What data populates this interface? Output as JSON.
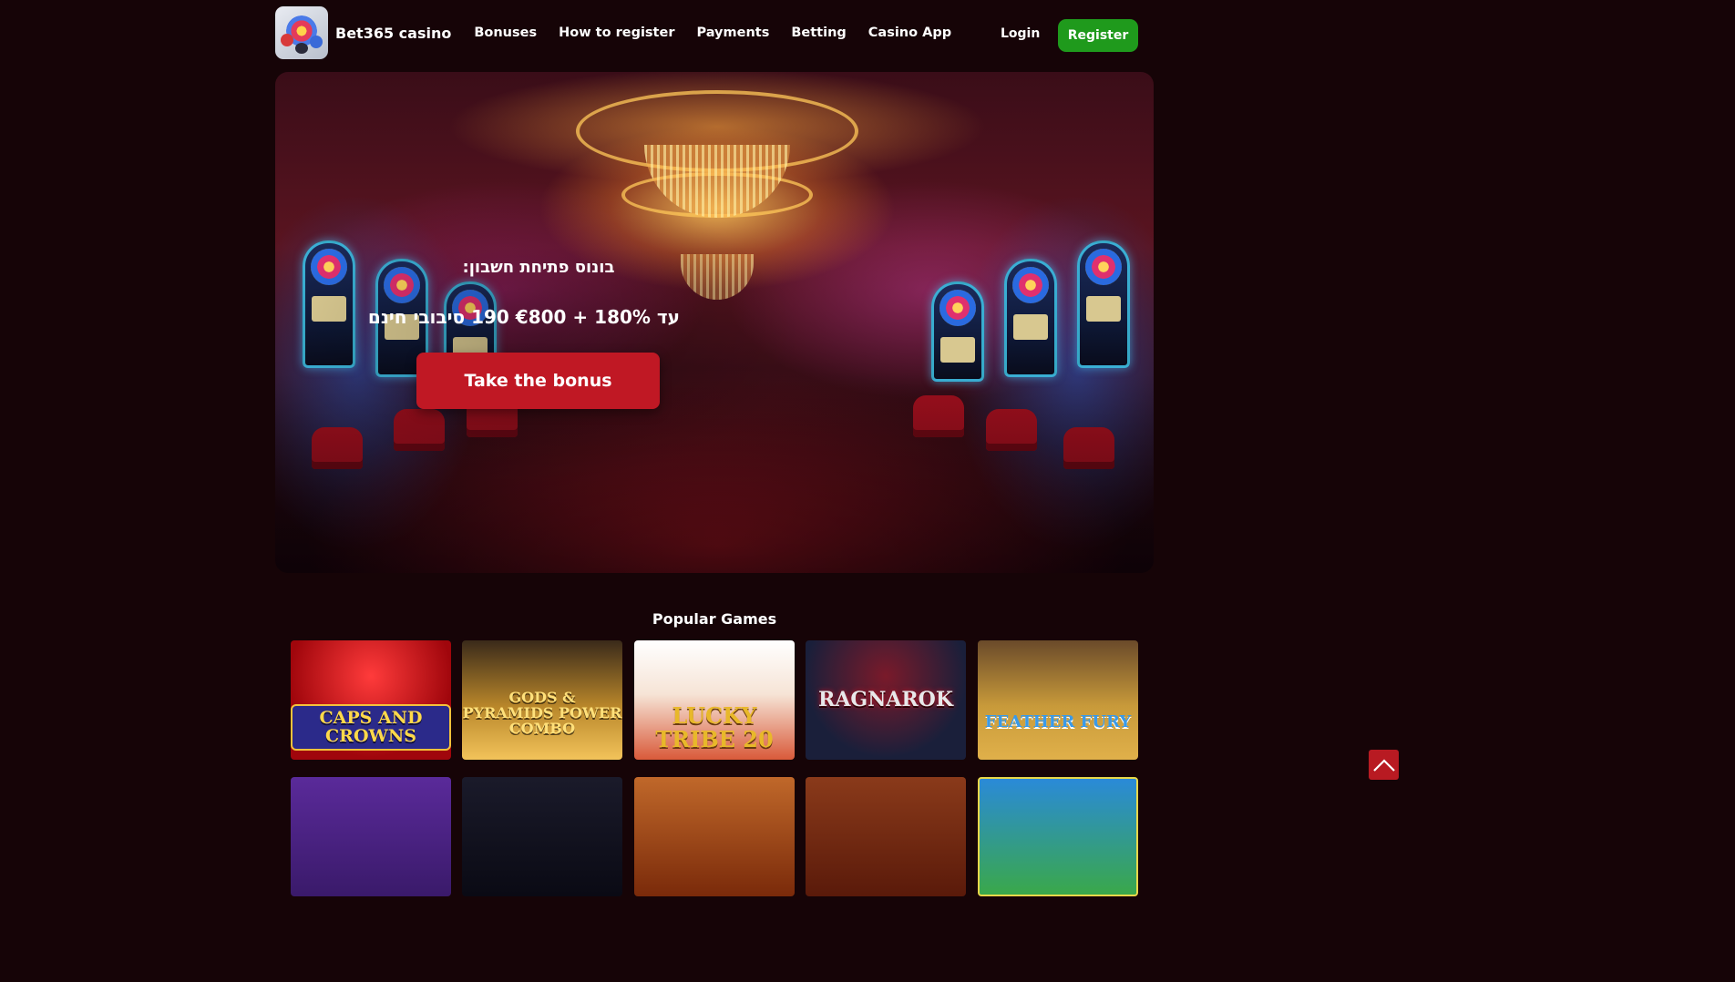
{
  "header": {
    "brand": "Bet365 casino",
    "nav": [
      "Bonuses",
      "How to register",
      "Payments",
      "Betting",
      "Casino App"
    ],
    "login": "Login",
    "register": "Register"
  },
  "hero": {
    "title": "בונוס פתיחת חשבון:",
    "offer": "עד 180% + €800 190 סיבובי חינם",
    "cta": "Take the bonus"
  },
  "games_section": {
    "title": "Popular Games",
    "games": [
      {
        "name": "CAPS AND CROWNS"
      },
      {
        "name": "GODS & PYRAMIDS POWER COMBO"
      },
      {
        "name": "LUCKY TRIBE 20"
      },
      {
        "name": "RAGNAROK"
      },
      {
        "name": "FEATHER FURY"
      }
    ]
  },
  "colors": {
    "background": "#160407",
    "register": "#1f9a1c",
    "cta": "#c01824",
    "to_top": "#b81a22"
  },
  "icons": [
    "logo-icon",
    "arrow-up-icon"
  ]
}
